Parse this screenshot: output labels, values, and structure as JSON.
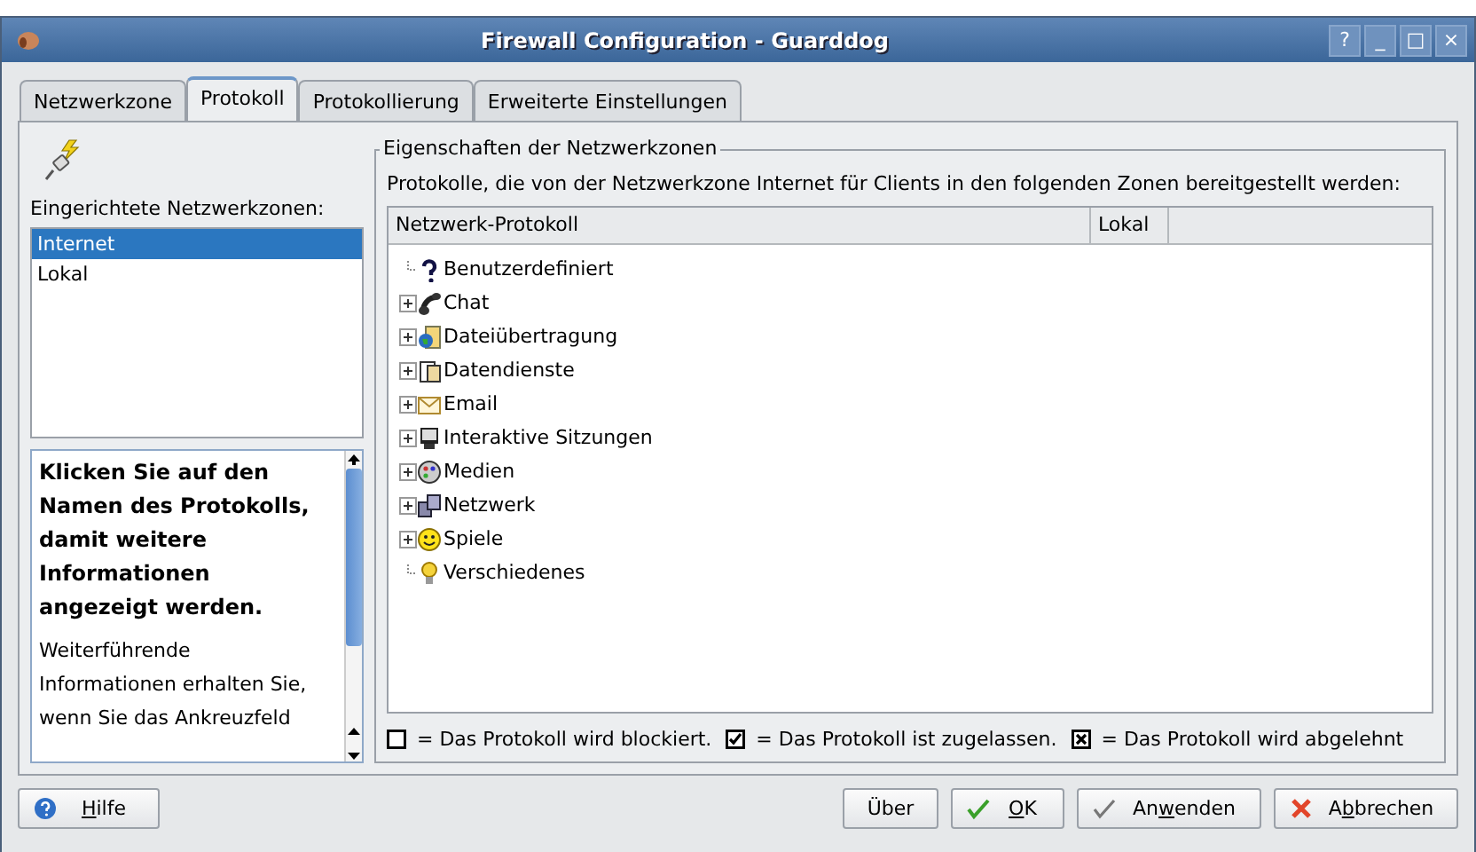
{
  "window": {
    "title": "Firewall Configuration - Guarddog",
    "controls": [
      "?",
      "_",
      "□",
      "×"
    ]
  },
  "tabs": [
    {
      "label": "Netzwerkzone",
      "selected": false
    },
    {
      "label": "Protokoll",
      "selected": true
    },
    {
      "label": "Protokollierung",
      "selected": false
    },
    {
      "label": "Erweiterte Einstellungen",
      "selected": false
    }
  ],
  "zones": {
    "label": "Eingerichtete Netzwerkzonen:",
    "items": [
      {
        "label": "Internet",
        "selected": true
      },
      {
        "label": "Lokal",
        "selected": false
      }
    ]
  },
  "help": {
    "heading": "Klicken Sie auf den Namen des Protokolls, damit weitere Informationen angezeigt werden.",
    "text": "Weiterführende Informationen erhalten Sie, wenn Sie das Ankreuzfeld"
  },
  "group": {
    "title": "Eigenschaften der Netzwerkzonen",
    "description": "Protokolle, die von der Netzwerkzone Internet für Clients in den folgenden Zonen bereitgestellt werden:"
  },
  "table": {
    "columns": [
      "Netzwerk-Protokoll",
      "Lokal"
    ],
    "rows": [
      {
        "label": "Benutzerdefiniert",
        "kind": "question",
        "expandable": false
      },
      {
        "label": "Chat",
        "kind": "phone",
        "expandable": true
      },
      {
        "label": "Dateiübertragung",
        "kind": "globe",
        "expandable": true
      },
      {
        "label": "Datendienste",
        "kind": "document",
        "expandable": true
      },
      {
        "label": "Email",
        "kind": "envelope",
        "expandable": true
      },
      {
        "label": "Interaktive Sitzungen",
        "kind": "monitor",
        "expandable": true
      },
      {
        "label": "Medien",
        "kind": "palette",
        "expandable": true
      },
      {
        "label": "Netzwerk",
        "kind": "computers",
        "expandable": true
      },
      {
        "label": "Spiele",
        "kind": "smiley",
        "expandable": true
      },
      {
        "label": "Verschiedenes",
        "kind": "bulb",
        "expandable": false
      }
    ]
  },
  "legend": [
    {
      "kind": "empty",
      "text": "= Das Protokoll wird blockiert."
    },
    {
      "kind": "checked",
      "text": "= Das Protokoll ist zugelassen."
    },
    {
      "kind": "crossed",
      "text": "= Das Protokoll wird abgelehnt"
    }
  ],
  "buttons_left": [
    {
      "kind": "help",
      "label": [
        {
          "text": "H",
          "underlined": true
        },
        {
          "text": "ilfe",
          "underlined": false
        }
      ]
    }
  ],
  "buttons_right": [
    {
      "kind": "plain",
      "label": [
        {
          "text": "Über",
          "underlined": false
        }
      ]
    },
    {
      "kind": "ok",
      "label": [
        {
          "text": "O",
          "underlined": true
        },
        {
          "text": "K",
          "underlined": false
        }
      ]
    },
    {
      "kind": "apply",
      "label": [
        {
          "text": "An",
          "underlined": false
        },
        {
          "text": "w",
          "underlined": true
        },
        {
          "text": "enden",
          "underlined": false
        }
      ]
    },
    {
      "kind": "cancel",
      "label": [
        {
          "text": "A",
          "underlined": false
        },
        {
          "text": "b",
          "underlined": true
        },
        {
          "text": "brechen",
          "underlined": false
        }
      ]
    }
  ]
}
